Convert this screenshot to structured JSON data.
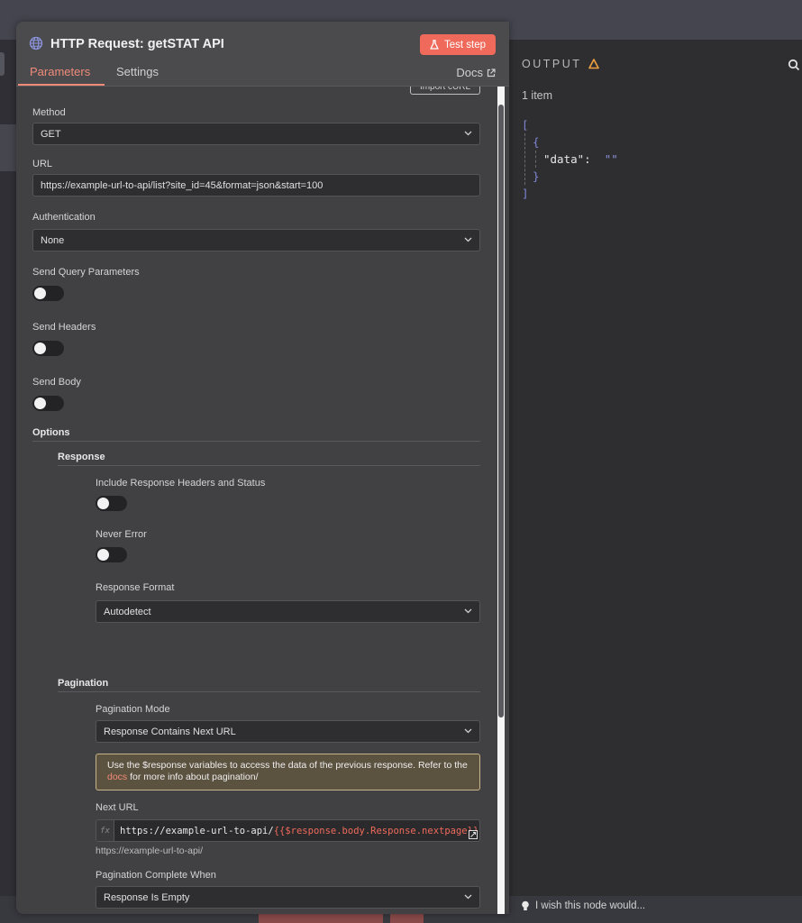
{
  "modal": {
    "title": "HTTP Request: getSTAT API",
    "test_step_label": "Test step",
    "tabs": [
      {
        "label": "Parameters",
        "active": true
      },
      {
        "label": "Settings",
        "active": false
      }
    ],
    "docs_label": "Docs",
    "import_curl_label": "Import cURL"
  },
  "params": {
    "method": {
      "label": "Method",
      "value": "GET"
    },
    "url": {
      "label": "URL",
      "value": "https://example-url-to-api/list?site_id=45&format=json&start=100"
    },
    "authentication": {
      "label": "Authentication",
      "value": "None"
    },
    "send_query": {
      "label": "Send Query Parameters",
      "on": false
    },
    "send_headers": {
      "label": "Send Headers",
      "on": false
    },
    "send_body": {
      "label": "Send Body",
      "on": false
    }
  },
  "options": {
    "title": "Options",
    "response": {
      "title": "Response",
      "include_headers": {
        "label": "Include Response Headers and Status",
        "on": false
      },
      "never_error": {
        "label": "Never Error",
        "on": false
      },
      "format": {
        "label": "Response Format",
        "value": "Autodetect"
      }
    },
    "pagination": {
      "title": "Pagination",
      "mode": {
        "label": "Pagination Mode",
        "value": "Response Contains Next URL"
      },
      "notice_pre": "Use the $response variables to access the data of the previous response. Refer to the ",
      "notice_link": "docs",
      "notice_post": " for more info about pagination/",
      "next_url": {
        "label": "Next URL",
        "fx": "fx",
        "literal": "https://example-url-to-api/",
        "expression": "{{$response.body.Response.nextpage}}",
        "preview": "https://example-url-to-api/"
      },
      "complete_when": {
        "label": "Pagination Complete When",
        "value": "Response Is Empty"
      }
    }
  },
  "output": {
    "title": "OUTPUT",
    "count": "1 item",
    "json_open": "[",
    "obj_open": "{",
    "key": "\"data\"",
    "colon": ":",
    "value": "\"\"",
    "obj_close": "}",
    "json_close": "]"
  },
  "footer": {
    "hint": "I wish this node would..."
  },
  "colors": {
    "accent": "#ef6a5b",
    "json_bracket": "#7f86d4",
    "warning": "#f0a040"
  }
}
